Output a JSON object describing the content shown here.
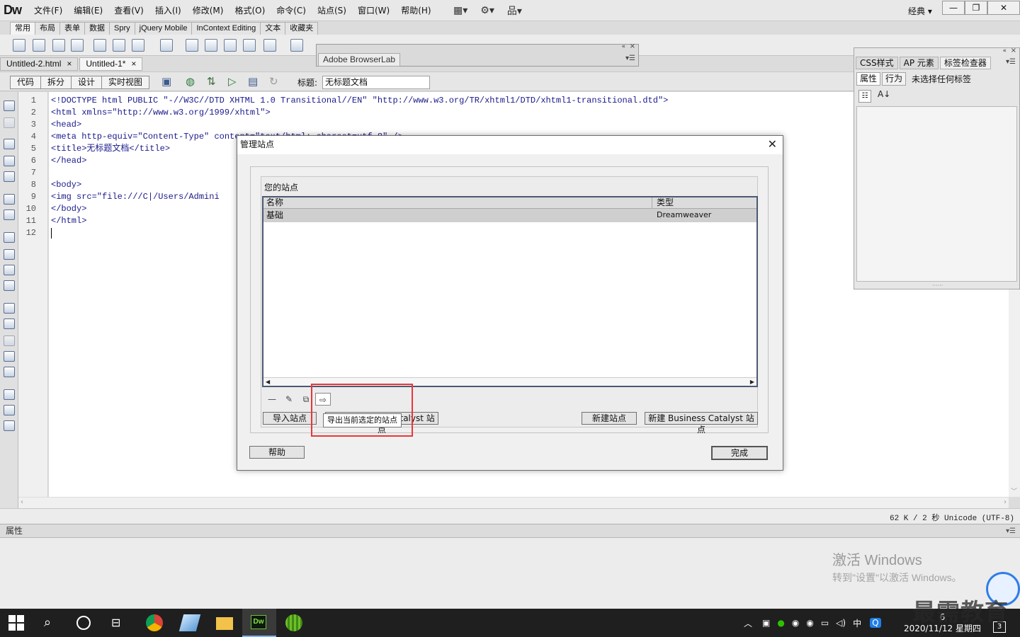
{
  "app": {
    "logo": "Dw"
  },
  "menubar": {
    "items": [
      "文件(F)",
      "编辑(E)",
      "查看(V)",
      "插入(I)",
      "修改(M)",
      "格式(O)",
      "命令(C)",
      "站点(S)",
      "窗口(W)",
      "帮助(H)"
    ],
    "workspace": "经典",
    "window_controls": [
      "—",
      "❐",
      "✕"
    ]
  },
  "insert_tabs": [
    "常用",
    "布局",
    "表单",
    "数据",
    "Spry",
    "jQuery Mobile",
    "InContext Editing",
    "文本",
    "收藏夹"
  ],
  "doc_tabs": [
    {
      "label": "Untitled-2.html"
    },
    {
      "label": "Untitled-1*"
    }
  ],
  "doc_toolbar": {
    "views": [
      "代码",
      "拆分",
      "设计",
      "实时视图"
    ],
    "title_label": "标题:",
    "title_value": "无标题文档"
  },
  "browserlab": {
    "tab": "Adobe BrowserLab"
  },
  "code": {
    "line_numbers": [
      "1",
      "2",
      "3",
      "4",
      "5",
      "6",
      "7",
      "8",
      "9",
      "10",
      "11",
      "12"
    ],
    "lines": [
      "<!DOCTYPE html PUBLIC \"-//W3C//DTD XHTML 1.0 Transitional//EN\" \"http://www.w3.org/TR/xhtml1/DTD/xhtml1-transitional.dtd\">",
      "<html xmlns=\"http://www.w3.org/1999/xhtml\">",
      "<head>",
      "<meta http-equiv=\"Content-Type\" content=\"text/html; charset=utf-8\" />",
      "<title>无标题文档</title>",
      "</head>",
      "",
      "<body>",
      "<img src=\"file:///C|/Users/Admini",
      "</body>",
      "</html>",
      ""
    ]
  },
  "status": {
    "text": "62 K / 2 秒 Unicode (UTF-8)"
  },
  "properties_panel": {
    "title": "属性"
  },
  "right_panel": {
    "tabs": [
      "CSS样式",
      "AP 元素",
      "标签检查器"
    ],
    "sub_tabs": [
      "属性",
      "行为"
    ],
    "message": "未选择任何标签"
  },
  "dialog": {
    "title": "管理站点",
    "close": "✕",
    "sites_label": "您的站点",
    "columns": [
      "名称",
      "类型"
    ],
    "rows": [
      {
        "name": "基础",
        "type": "Dreamweaver"
      }
    ],
    "buttons": {
      "import": "导入站点",
      "import_bc": "导入 Business Catalyst 站点",
      "new_site": "新建站点",
      "new_bc": "新建 Business Catalyst 站点",
      "help": "帮助",
      "done": "完成"
    },
    "tooltip": "导出当前选定的站点"
  },
  "activation": {
    "line1": "激活 Windows",
    "line2": "转到\"设置\"以激活 Windows。"
  },
  "taskbar": {
    "ime": "中",
    "time": "6",
    "date": "2020/11/12 星期四",
    "notifications": "3"
  },
  "watermark": {
    "text": "最需教育"
  },
  "colors": {
    "highlight": "#e8363a",
    "taskbar": "#1f1f1f",
    "code_tag": "#1a1a8c"
  }
}
